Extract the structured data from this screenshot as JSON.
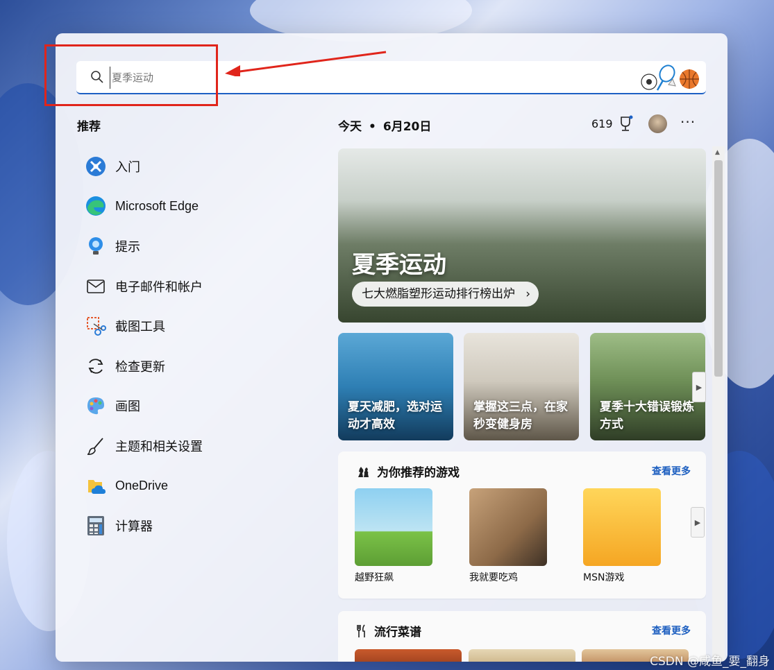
{
  "search": {
    "placeholder": "夏季运动"
  },
  "sidebar": {
    "title": "推荐",
    "apps": [
      {
        "label": "入门",
        "icon": "getstarted-icon"
      },
      {
        "label": "Microsoft Edge",
        "icon": "edge-icon"
      },
      {
        "label": "提示",
        "icon": "tips-icon"
      },
      {
        "label": "电子邮件和帐户",
        "icon": "mail-icon"
      },
      {
        "label": "截图工具",
        "icon": "snipping-tool-icon"
      },
      {
        "label": "检查更新",
        "icon": "refresh-icon"
      },
      {
        "label": "画图",
        "icon": "paint-icon"
      },
      {
        "label": "主题和相关设置",
        "icon": "brush-icon"
      },
      {
        "label": "OneDrive",
        "icon": "onedrive-icon"
      },
      {
        "label": "计算器",
        "icon": "calculator-icon"
      }
    ]
  },
  "header": {
    "today": "今天",
    "date": "6月20日",
    "points": "619"
  },
  "hero": {
    "title": "夏季运动",
    "pill": "七大燃脂塑形运动排行榜出炉"
  },
  "tiles": [
    {
      "caption": "夏天减肥，选对运动才高效"
    },
    {
      "caption": "掌握这三点，在家秒变健身房"
    },
    {
      "caption": "夏季十大错误锻炼方式"
    }
  ],
  "games_card": {
    "title": "为你推荐的游戏",
    "more": "查看更多",
    "games": [
      {
        "name": "越野狂飙"
      },
      {
        "name": "我就要吃鸡"
      },
      {
        "name": "MSN游戏"
      }
    ]
  },
  "recipes_card": {
    "title": "流行菜谱",
    "more": "查看更多"
  },
  "watermark": "CSDN @咸鱼_要_翻身",
  "colors": {
    "accent": "#1d60c4",
    "annotation": "#e0251b"
  }
}
